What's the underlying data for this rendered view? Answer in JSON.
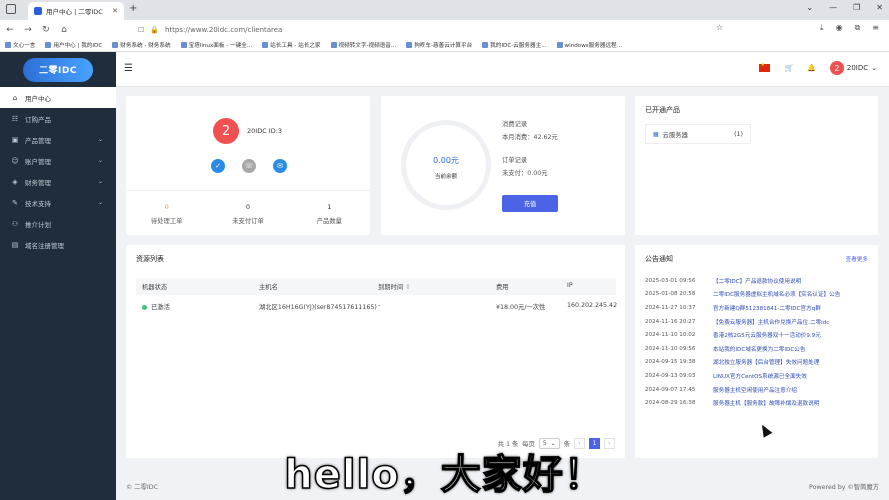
{
  "browser": {
    "tab_title": "用户中心 | 二零IDC",
    "url": "https://www.20idc.com/clientarea",
    "bookmarks": [
      "文心一言",
      "用户中心 | 我的IDC",
      "财务系统 - 财务系统",
      "宝塔linux面板 - 一键全...",
      "站长工具 - 站长之家",
      "视频转文字-视频语音...",
      "狗咚车-慈善云计算平台",
      "我的IDC-云服务器主...",
      "windows服务器远程..."
    ]
  },
  "sidebar": {
    "logo": "二零IDC",
    "items": [
      {
        "label": "用户中心",
        "icon": "home-icon",
        "active": true,
        "has_arrow": false
      },
      {
        "label": "订购产品",
        "icon": "cart-icon",
        "active": false,
        "has_arrow": false
      },
      {
        "label": "产品管理",
        "icon": "box-icon",
        "active": false,
        "has_arrow": true
      },
      {
        "label": "账户管理",
        "icon": "user-icon",
        "active": false,
        "has_arrow": true
      },
      {
        "label": "财务管理",
        "icon": "finance-icon",
        "active": false,
        "has_arrow": true
      },
      {
        "label": "技术支持",
        "icon": "support-icon",
        "active": false,
        "has_arrow": true
      },
      {
        "label": "推介计划",
        "icon": "referral-icon",
        "active": false,
        "has_arrow": false
      },
      {
        "label": "域名注册管理",
        "icon": "domain-icon",
        "active": false,
        "has_arrow": false
      }
    ]
  },
  "header": {
    "username": "20IDC",
    "avatar_char": "2"
  },
  "profile": {
    "avatar_char": "2",
    "user_id": "20IDC ID:3",
    "stats": [
      {
        "value": "0",
        "label": "待处理工单"
      },
      {
        "value": "0",
        "label": "未支付订单"
      },
      {
        "value": "1",
        "label": "产品数量"
      }
    ]
  },
  "balance": {
    "amount": "0.00元",
    "label": "当前余额",
    "consume_title": "消费记录",
    "consume_month": "本月消费：42.62元",
    "order_title": "订单记录",
    "order_unpaid": "未支付：0.00元",
    "recharge": "充值"
  },
  "products": {
    "title": "已开通产品",
    "items": [
      {
        "name": "云服务器",
        "count": "(1)"
      }
    ]
  },
  "resources": {
    "title": "资源列表",
    "columns": [
      "机器状态",
      "主机名",
      "到期时间",
      "费用",
      "IP"
    ],
    "rows": [
      {
        "status": "已激活",
        "host": "湖北区16H16G(YJ)(ser874517611165)",
        "expire": "-",
        "fee": "¥18.00元/一次性",
        "ip": "160.202.245.42"
      }
    ],
    "pager": {
      "total": "共 1 条",
      "per_page_label": "每页",
      "per_page": "5",
      "unit": "条",
      "current": "1",
      "prev": "‹",
      "next": "›"
    }
  },
  "notices": {
    "title": "公告通知",
    "more": "查看更多",
    "items": [
      {
        "date": "2025-03-01 09:56",
        "text": "【二零IDC】产品退款协议使用说明"
      },
      {
        "date": "2025-01-08 20:58",
        "text": "二零IDC服务器虚拟主机域名必须【实名认证】公告"
      },
      {
        "date": "2024-11-27 10:37",
        "text": "官方新建Q群512381841-二零IDC官方q群"
      },
      {
        "date": "2024-11-16 20:27",
        "text": "【免费云服务器】主机合作兑换产品位:二零idc"
      },
      {
        "date": "2024-11-10 10:02",
        "text": "香港2核2G5元云服务器双十一活动价9.9元"
      },
      {
        "date": "2024-11-10 09:56",
        "text": "本站我的IDC域名更换为二零IDC公告"
      },
      {
        "date": "2024-09-15 19:38",
        "text": "湖北独立服务器【后台管理】失效问题处理"
      },
      {
        "date": "2024-09-13 09:03",
        "text": "LINUX官方CentOS系统源已全面失效"
      },
      {
        "date": "2024-09-07 17:45",
        "text": "服务器主机空闲使用产品注意介绍"
      },
      {
        "date": "2024-08-29 16:38",
        "text": "服务器主机【服务款】故障补偿及退款说明"
      }
    ]
  },
  "footer": {
    "left": "© 二零IDC",
    "right": "Powered by ©智简魔方"
  },
  "subtitle": "hello，大家好！",
  "colors": {
    "sidebar_bg": "#1f2d3d",
    "accent": "#4b63e6",
    "avatar": "#f0504f",
    "active_status": "#3ec47c"
  }
}
